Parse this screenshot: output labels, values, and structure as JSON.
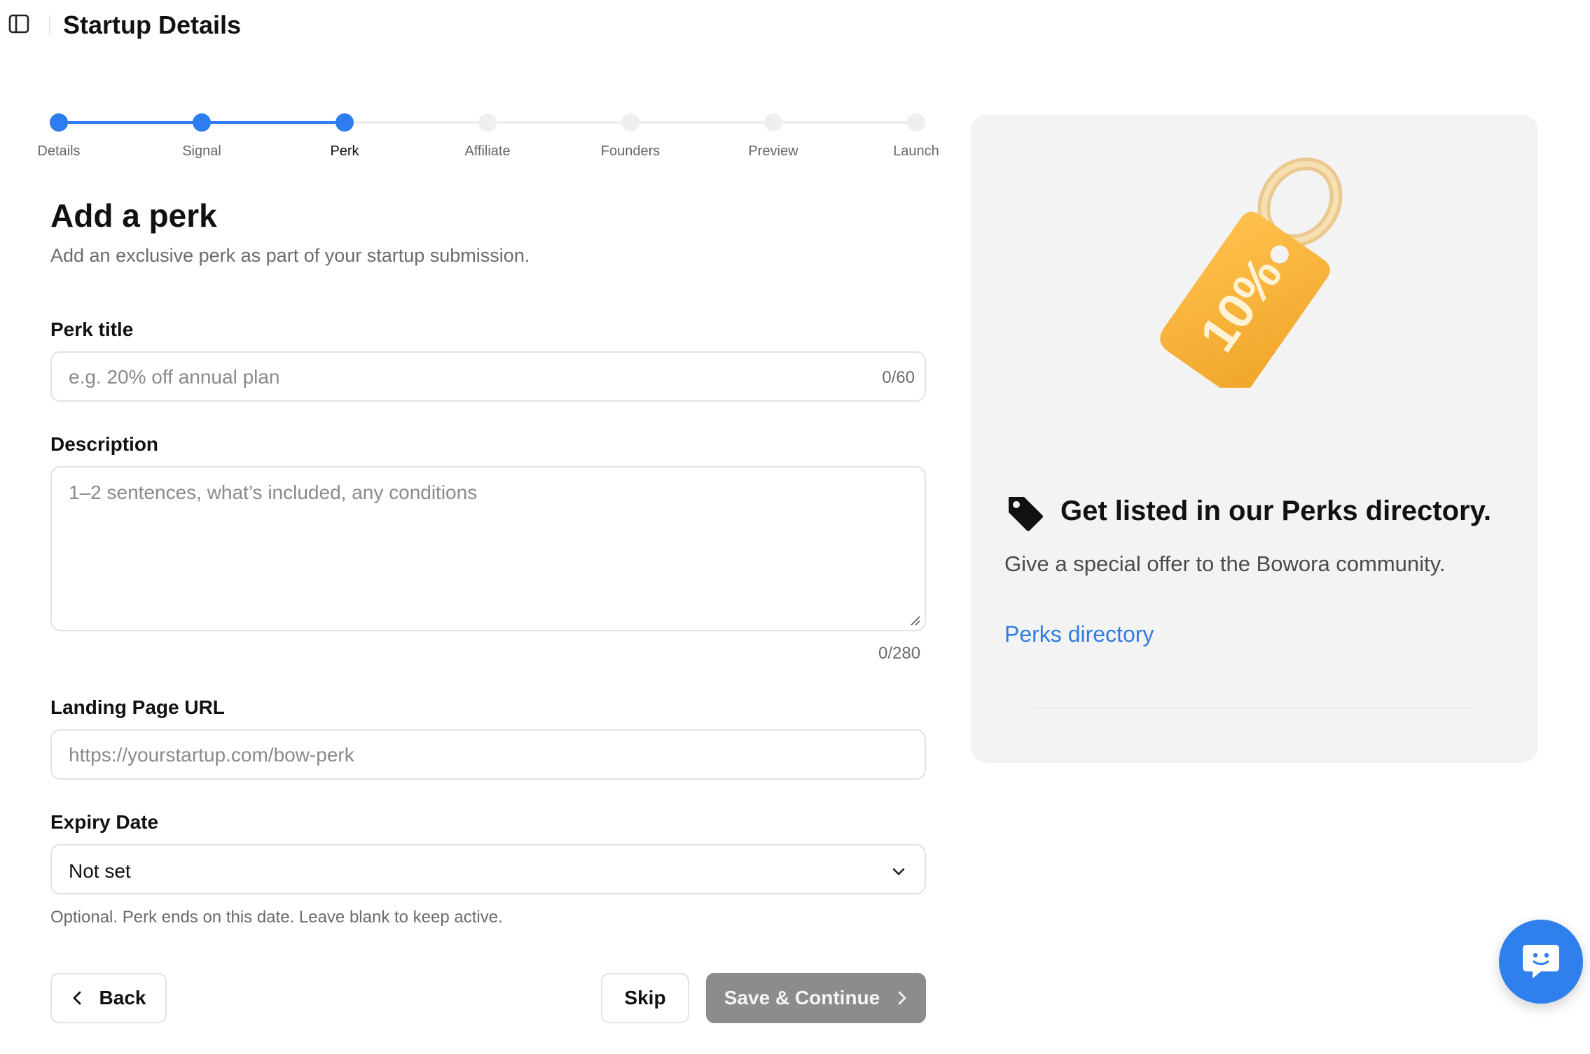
{
  "header": {
    "title": "Startup Details",
    "toggle_icon": "sidebar-toggle-icon"
  },
  "stepper": {
    "current_index": 2,
    "steps": [
      {
        "label": "Details",
        "state": "done"
      },
      {
        "label": "Signal",
        "state": "done"
      },
      {
        "label": "Perk",
        "state": "current"
      },
      {
        "label": "Affiliate",
        "state": "todo"
      },
      {
        "label": "Founders",
        "state": "todo"
      },
      {
        "label": "Preview",
        "state": "todo"
      },
      {
        "label": "Launch",
        "state": "todo"
      }
    ],
    "active_color": "#2d7cf0",
    "inactive_color": "#efefef"
  },
  "form": {
    "heading": "Add a perk",
    "subheading": "Add an exclusive perk as part of your startup submission.",
    "perk_title": {
      "label": "Perk title",
      "value": "",
      "placeholder": "e.g. 20% off annual plan",
      "counter": "0/60"
    },
    "description": {
      "label": "Description",
      "value": "",
      "placeholder": "1–2 sentences, what’s included, any conditions",
      "counter": "0/280"
    },
    "landing_url": {
      "label": "Landing Page URL",
      "value": "",
      "placeholder": "https://yourstartup.com/bow-perk"
    },
    "expiry": {
      "label": "Expiry Date",
      "value": "Not set",
      "helper": "Optional. Perk ends on this date. Leave blank to keep active."
    }
  },
  "actions": {
    "back_label": "Back",
    "skip_label": "Skip",
    "save_label": "Save & Continue"
  },
  "panel": {
    "illustration_text": "10%",
    "title": "Get listed in our Perks directory.",
    "description": "Give a special offer to the Bowora community.",
    "link_label": "Perks directory",
    "link_color": "#2f7de1",
    "background": "#f3f3f3"
  },
  "chat": {
    "icon": "chat-support-icon",
    "color": "#2f80ed"
  }
}
